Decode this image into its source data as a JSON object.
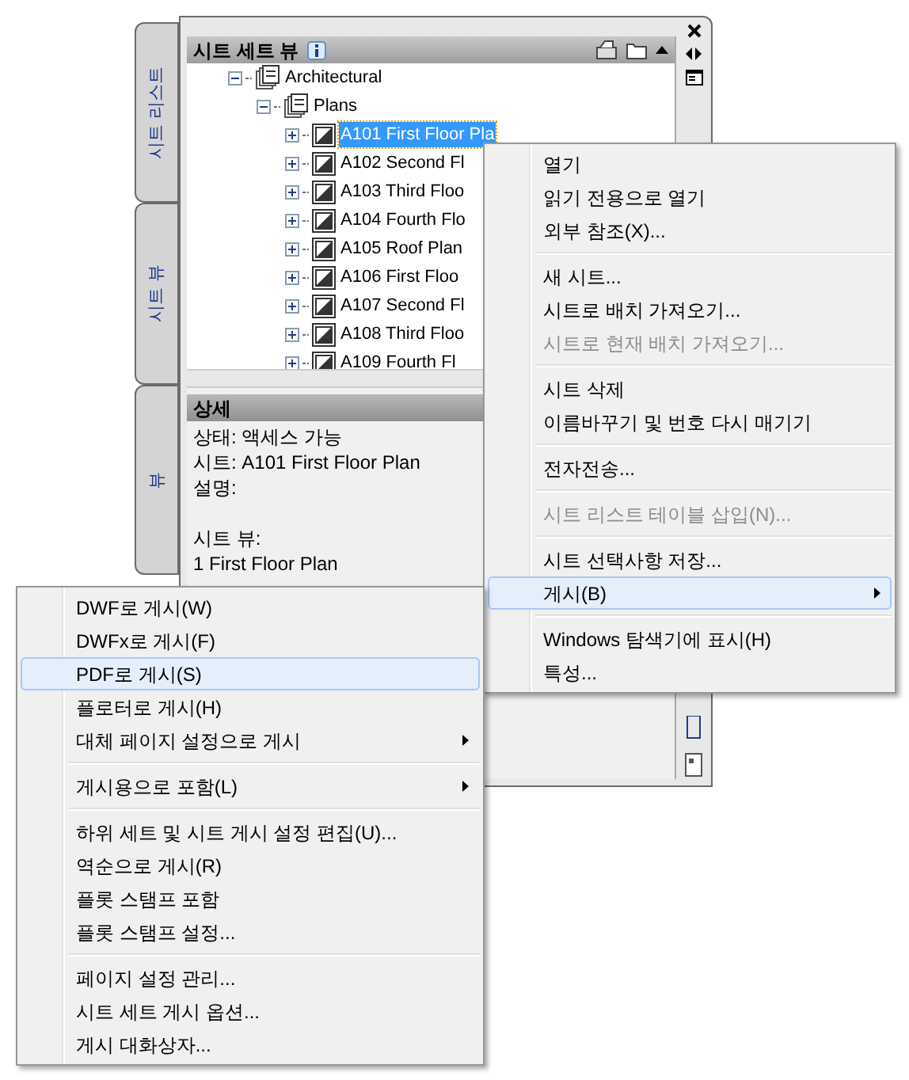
{
  "side_tabs": [
    {
      "label": "시트 리스트"
    },
    {
      "label": "시트 뷰"
    },
    {
      "label": "뷰"
    }
  ],
  "panel": {
    "title": "시트 세트 뷰"
  },
  "tree": [
    {
      "label": "Architectural",
      "expanded": true,
      "children": [
        {
          "label": "Plans",
          "expanded": true,
          "children": [
            {
              "label": "A101 First Floor Pla",
              "selected": true
            },
            {
              "label": "A102 Second Fl",
              "selected": false
            },
            {
              "label": "A103 Third Floo",
              "selected": false
            },
            {
              "label": "A104 Fourth Flo",
              "selected": false
            },
            {
              "label": "A105 Roof Plan",
              "selected": false
            },
            {
              "label": "A106 First Floo",
              "selected": false
            },
            {
              "label": "A107 Second Fl",
              "selected": false
            },
            {
              "label": "A108 Third Floo",
              "selected": false
            },
            {
              "label": "A109 Fourth Fl",
              "selected": false
            }
          ]
        }
      ]
    }
  ],
  "details": {
    "title": "상세",
    "lines": [
      "상태: 액세스 가능",
      "시트: A101 First Floor Plan",
      "설명:"
    ],
    "views_title": "시트 뷰:",
    "views": [
      "1 First Floor Plan"
    ]
  },
  "context_menu": [
    {
      "kind": "item",
      "label": "열기",
      "disabled": false,
      "selected": false,
      "submenu": false
    },
    {
      "kind": "item",
      "label": "읽기 전용으로 열기",
      "disabled": false,
      "selected": false,
      "submenu": false
    },
    {
      "kind": "item",
      "label": "외부 참조(X)...",
      "disabled": false,
      "selected": false,
      "submenu": false
    },
    {
      "kind": "separator"
    },
    {
      "kind": "item",
      "label": "새 시트...",
      "disabled": false,
      "selected": false,
      "submenu": false
    },
    {
      "kind": "item",
      "label": "시트로 배치 가져오기...",
      "disabled": false,
      "selected": false,
      "submenu": false
    },
    {
      "kind": "item",
      "label": "시트로 현재 배치 가져오기...",
      "disabled": true,
      "selected": false,
      "submenu": false
    },
    {
      "kind": "separator"
    },
    {
      "kind": "item",
      "label": "시트 삭제",
      "disabled": false,
      "selected": false,
      "submenu": false
    },
    {
      "kind": "item",
      "label": "이름바꾸기 및 번호 다시 매기기",
      "disabled": false,
      "selected": false,
      "submenu": false
    },
    {
      "kind": "separator"
    },
    {
      "kind": "item",
      "label": "전자전송...",
      "disabled": false,
      "selected": false,
      "submenu": false
    },
    {
      "kind": "separator"
    },
    {
      "kind": "item",
      "label": "시트 리스트 테이블 삽입(N)...",
      "disabled": true,
      "selected": false,
      "submenu": false
    },
    {
      "kind": "separator"
    },
    {
      "kind": "item",
      "label": "시트 선택사항 저장...",
      "disabled": false,
      "selected": false,
      "submenu": false
    },
    {
      "kind": "item",
      "label": "게시(B)",
      "disabled": false,
      "selected": true,
      "submenu": true
    },
    {
      "kind": "separator"
    },
    {
      "kind": "item",
      "label": "Windows 탐색기에 표시(H)",
      "disabled": false,
      "selected": false,
      "submenu": false
    },
    {
      "kind": "item",
      "label": "특성...",
      "disabled": false,
      "selected": false,
      "submenu": false
    }
  ],
  "publish_submenu": [
    {
      "kind": "item",
      "label": "DWF로 게시(W)",
      "disabled": false,
      "selected": false,
      "submenu": false
    },
    {
      "kind": "item",
      "label": "DWFx로 게시(F)",
      "disabled": false,
      "selected": false,
      "submenu": false
    },
    {
      "kind": "item",
      "label": "PDF로 게시(S)",
      "disabled": false,
      "selected": true,
      "submenu": false
    },
    {
      "kind": "item",
      "label": "플로터로 게시(H)",
      "disabled": false,
      "selected": false,
      "submenu": false
    },
    {
      "kind": "item",
      "label": "대체 페이지 설정으로 게시",
      "disabled": false,
      "selected": false,
      "submenu": true
    },
    {
      "kind": "separator"
    },
    {
      "kind": "item",
      "label": "게시용으로 포함(L)",
      "disabled": false,
      "selected": false,
      "submenu": true
    },
    {
      "kind": "separator"
    },
    {
      "kind": "item",
      "label": "하위 세트 및 시트 게시 설정 편집(U)...",
      "disabled": false,
      "selected": false,
      "submenu": false
    },
    {
      "kind": "item",
      "label": "역순으로 게시(R)",
      "disabled": false,
      "selected": false,
      "submenu": false
    },
    {
      "kind": "item",
      "label": "플롯 스탬프 포함",
      "disabled": false,
      "selected": false,
      "submenu": false
    },
    {
      "kind": "item",
      "label": "플롯 스탬프 설정...",
      "disabled": false,
      "selected": false,
      "submenu": false
    },
    {
      "kind": "separator"
    },
    {
      "kind": "item",
      "label": "페이지 설정 관리...",
      "disabled": false,
      "selected": false,
      "submenu": false
    },
    {
      "kind": "item",
      "label": "시트 세트 게시 옵션...",
      "disabled": false,
      "selected": false,
      "submenu": false
    },
    {
      "kind": "item",
      "label": "게시 대화상자...",
      "disabled": false,
      "selected": false,
      "submenu": false
    }
  ]
}
